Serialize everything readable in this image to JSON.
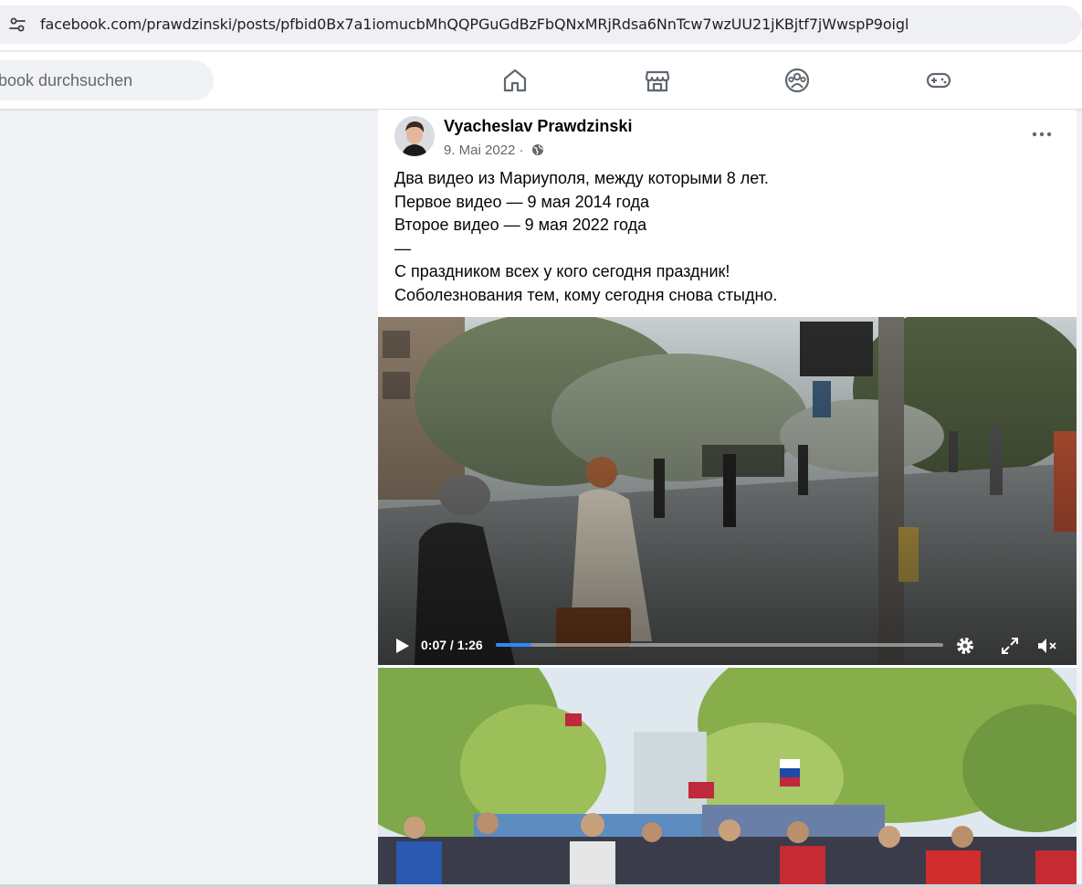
{
  "browser": {
    "url": "facebook.com/prawdzinski/posts/pfbid0Bx7a1iomucbMhQQPGuGdBzFbQNxMRjRdsa6NnTcw7wzUU21jKBjtf7jWwspP9oigl",
    "site_info_icon": "tune-icon"
  },
  "nav": {
    "search_placeholder": "book durchsuchen",
    "icons": [
      "home-icon",
      "marketplace-icon",
      "groups-icon",
      "gaming-icon"
    ]
  },
  "post": {
    "author": "Vyacheslav Prawdzinski",
    "date": "9. Mai 2022 ·",
    "visibility_icon": "globe-icon",
    "more_icon": "more-options-icon",
    "text_lines": [
      "Два видео из Мариуполя, между которыми 8 лет.",
      "Первое видео — 9 мая 2014 года",
      "Второе видео — 9 мая 2022 года",
      "—",
      "С праздником всех у кого сегодня праздник!",
      "Соболезнования тем, кому сегодня снова стыдно."
    ],
    "video1": {
      "time": "0:07 / 1:26",
      "progress": 0.079,
      "icons": [
        "play-icon",
        "settings-icon",
        "fullscreen-icon",
        "mute-icon"
      ]
    }
  },
  "colors": {
    "accent": "#2d88ff",
    "background": "#f0f2f5",
    "text": "#050505",
    "secondary_text": "#65676b"
  }
}
